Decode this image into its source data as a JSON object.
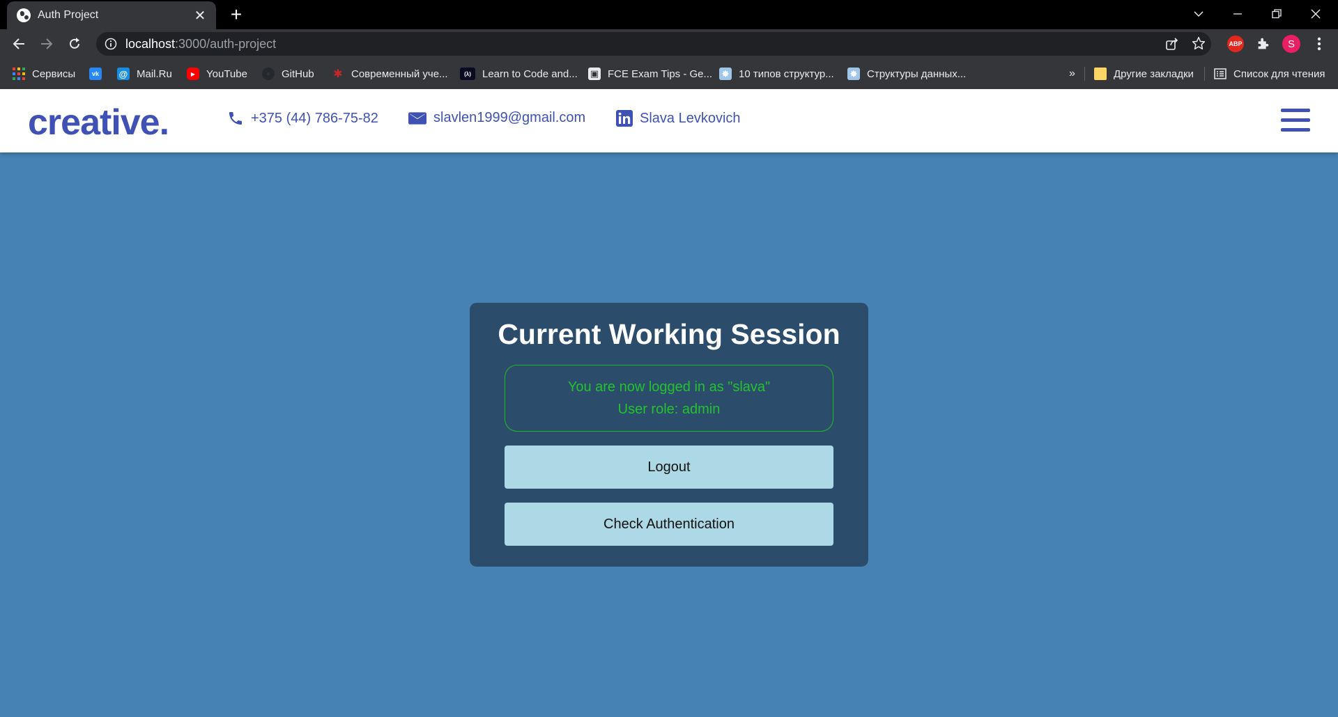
{
  "browser": {
    "tab_title": "Auth Project",
    "tab_close": "✕",
    "new_tab": "+",
    "url_host": "localhost",
    "url_rest": ":3000/auth-project",
    "profile_letter": "S",
    "abp_label": "ABP"
  },
  "bookmarks": {
    "items": [
      {
        "label": "Сервисы",
        "icon": "apps-grid-icon",
        "color": "#ea4335"
      },
      {
        "label": "",
        "icon": "vk-icon",
        "color": "#2787f5",
        "glyph": "vk"
      },
      {
        "label": "Mail.Ru",
        "icon": "mailru-icon",
        "color": "#168de2",
        "glyph": "@"
      },
      {
        "label": "YouTube",
        "icon": "youtube-icon",
        "color": "#ff0000",
        "glyph": "▶"
      },
      {
        "label": "GitHub",
        "icon": "github-icon",
        "color": "#24292e",
        "glyph": "●"
      },
      {
        "label": "Современный уче...",
        "icon": "js-tutorial-icon",
        "color": "#c62828",
        "glyph": "✱"
      },
      {
        "label": "Learn to Code and...",
        "icon": "freecodecamp-icon",
        "color": "#0a0a23",
        "glyph": "(λ)"
      },
      {
        "label": "FCE Exam Tips - Ge...",
        "icon": "fce-icon",
        "color": "#888888",
        "glyph": "▣"
      },
      {
        "label": "10 типов структур...",
        "icon": "habr-icon",
        "color": "#6fa8dc",
        "glyph": "✸"
      },
      {
        "label": "Структуры данных...",
        "icon": "habr-icon-2",
        "color": "#6fa8dc",
        "glyph": "✸"
      }
    ],
    "more": "»",
    "other_bookmarks": "Другие закладки",
    "reading_list": "Список для чтения"
  },
  "header": {
    "logo": "creative.",
    "phone": "+375 (44) 786-75-82",
    "email": "slavlen1999@gmail.com",
    "linkedin": "Slava Levkovich"
  },
  "session": {
    "title": "Current Working Session",
    "logged_in_line": "You are now logged in as \"slava\"",
    "role_line": "User role: admin",
    "logout_label": "Logout",
    "check_label": "Check Authentication"
  },
  "colors": {
    "page_background": "#4682b4",
    "card_background": "#2c4c6b",
    "brand": "#3f51b5",
    "status_green": "#22c32e",
    "button_background": "#add8e6"
  }
}
